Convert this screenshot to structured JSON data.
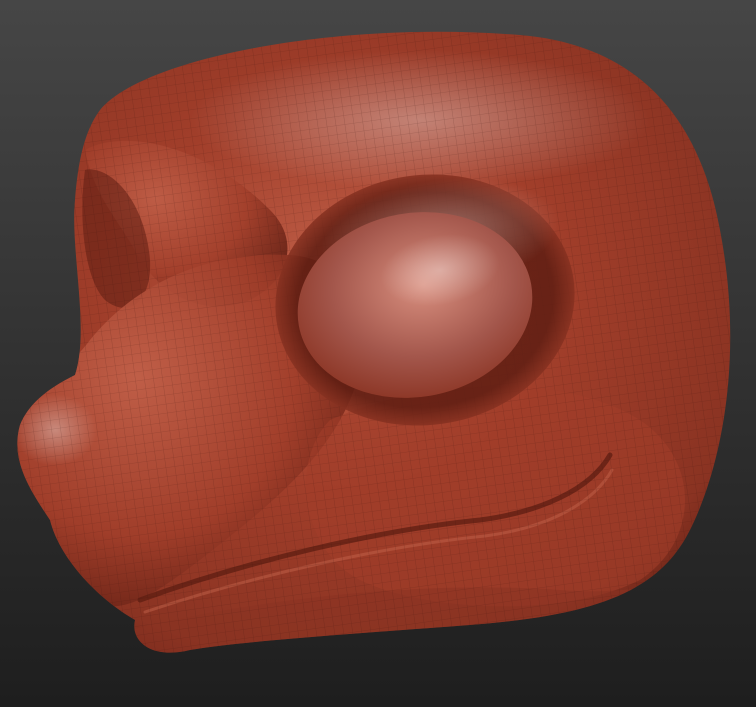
{
  "scene": {
    "subject_icon": "sculpted-head-model-icon",
    "colors": {
      "background_top": "#464646",
      "background_bottom": "#1e1e1e",
      "clay_base": "#a13e2a",
      "clay_dark": "#5e1d12",
      "clay_mid": "#8a3322",
      "clay_light": "#c2614a",
      "clay_highlight": "#d99080",
      "eye_fill": "#a3564b",
      "wire": "#3a120b"
    }
  }
}
